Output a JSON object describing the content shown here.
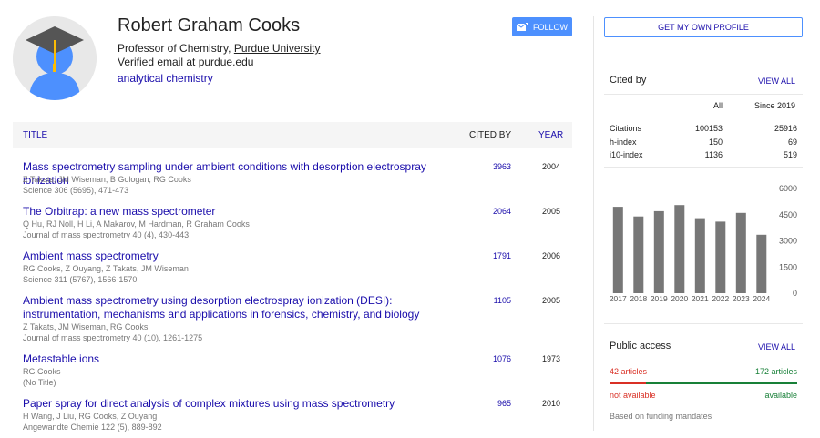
{
  "profile": {
    "name": "Robert Graham Cooks",
    "affiliation_prefix": "Professor of Chemistry, ",
    "affiliation_link": "Purdue University",
    "email": "Verified email at purdue.edu",
    "interest": "analytical chemistry",
    "follow_label": "FOLLOW",
    "own_profile_label": "GET MY OWN PROFILE"
  },
  "table": {
    "col_title": "TITLE",
    "col_cited": "CITED BY",
    "col_year": "YEAR",
    "rows": [
      {
        "title": "Mass spectrometry sampling under ambient conditions with desorption electrospray ionization",
        "authors": "Z Takats, JM Wiseman, B Gologan, RG Cooks",
        "venue": "Science 306 (5695), 471-473",
        "cited": "3963",
        "year": "2004"
      },
      {
        "title": "The Orbitrap: a new mass spectrometer",
        "authors": "Q Hu, RJ Noll, H Li, A Makarov, M Hardman, R Graham Cooks",
        "venue": "Journal of mass spectrometry 40 (4), 430-443",
        "cited": "2064",
        "year": "2005"
      },
      {
        "title": "Ambient mass spectrometry",
        "authors": "RG Cooks, Z Ouyang, Z Takats, JM Wiseman",
        "venue": "Science 311 (5767), 1566-1570",
        "cited": "1791",
        "year": "2006"
      },
      {
        "title": "Ambient mass spectrometry using desorption electrospray ionization (DESI): instrumentation, mechanisms and applications in forensics, chemistry, and biology",
        "authors": "Z Takats, JM Wiseman, RG Cooks",
        "venue": "Journal of mass spectrometry 40 (10), 1261-1275",
        "cited": "1105",
        "year": "2005"
      },
      {
        "title": "Metastable ions",
        "authors": "RG Cooks",
        "venue": "(No Title)",
        "cited": "1076",
        "year": "1973"
      },
      {
        "title": "Paper spray for direct analysis of complex mixtures using mass spectrometry",
        "authors": "H Wang, J Liu, RG Cooks, Z Ouyang",
        "venue": "Angewandte Chemie 122 (5), 889-892",
        "cited": "965",
        "year": "2010"
      }
    ]
  },
  "cited_by": {
    "title": "Cited by",
    "view_all": "VIEW ALL",
    "col_all": "All",
    "col_since": "Since 2019",
    "stats": [
      {
        "label": "Citations",
        "all": "100153",
        "since": "25916"
      },
      {
        "label": "h-index",
        "all": "150",
        "since": "69"
      },
      {
        "label": "i10-index",
        "all": "1136",
        "since": "519"
      }
    ]
  },
  "chart_data": {
    "type": "bar",
    "categories": [
      "2017",
      "2018",
      "2019",
      "2020",
      "2021",
      "2022",
      "2023",
      "2024"
    ],
    "values": [
      4950,
      4400,
      4700,
      5050,
      4300,
      4100,
      4600,
      3350
    ],
    "ylim": [
      0,
      6000
    ],
    "yticks": [
      "6000",
      "4500",
      "3000",
      "1500",
      "0"
    ],
    "bar_color": "#777777"
  },
  "public_access": {
    "title": "Public access",
    "view_all": "VIEW ALL",
    "left_count": "42 articles",
    "right_count": "172 articles",
    "left_label": "not available",
    "right_label": "available",
    "note": "Based on funding mandates",
    "available_fraction": 0.804
  }
}
